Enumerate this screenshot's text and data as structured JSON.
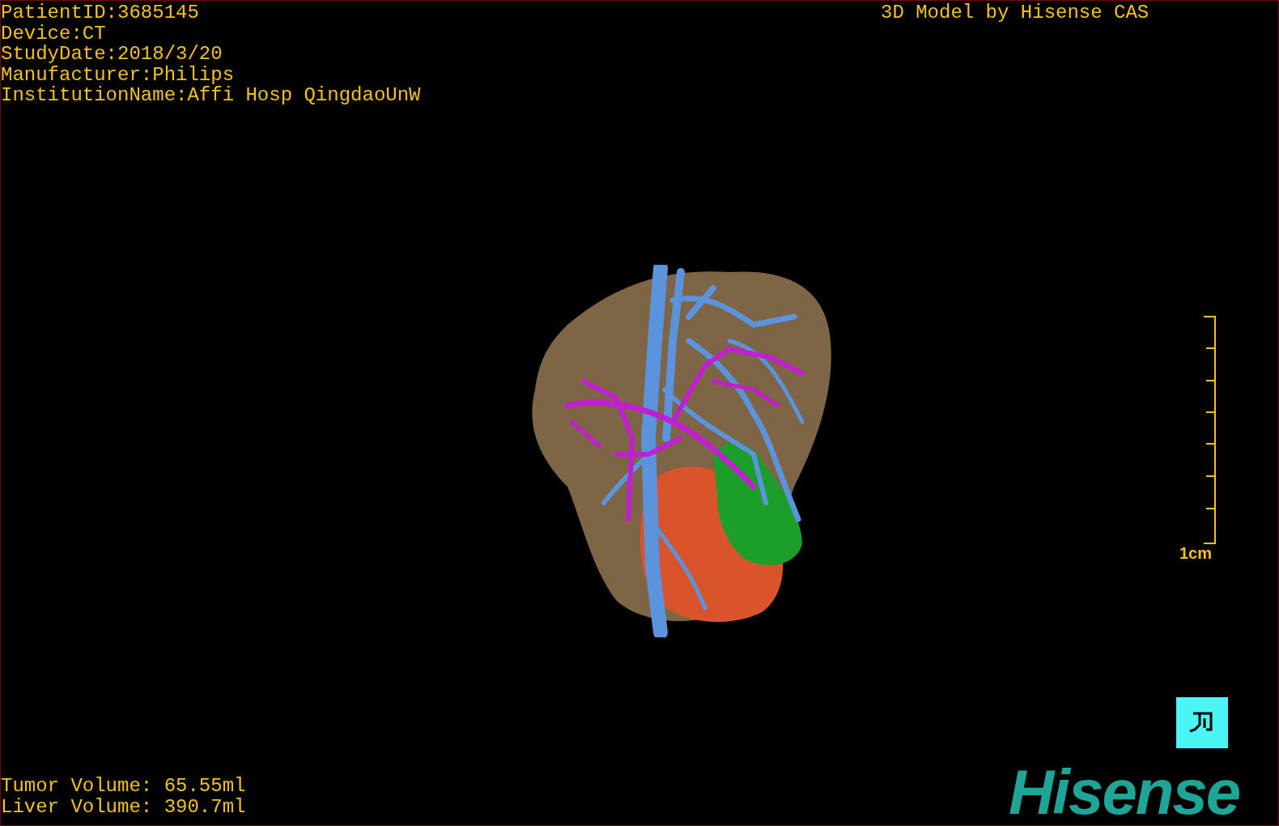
{
  "study_info": [
    "PatientID:3685145",
    "Device:CT",
    "StudyDate:2018/3/20",
    "Manufacturer:Philips",
    "InstitutionName:Affi Hosp QingdaoUnW"
  ],
  "model_credit": "3D Model by Hisense CAS",
  "scale_bar": {
    "label": "1cm"
  },
  "volumes": [
    "Tumor Volume: 65.55ml",
    "Liver Volume: 390.7ml"
  ],
  "logo": "Hisense"
}
